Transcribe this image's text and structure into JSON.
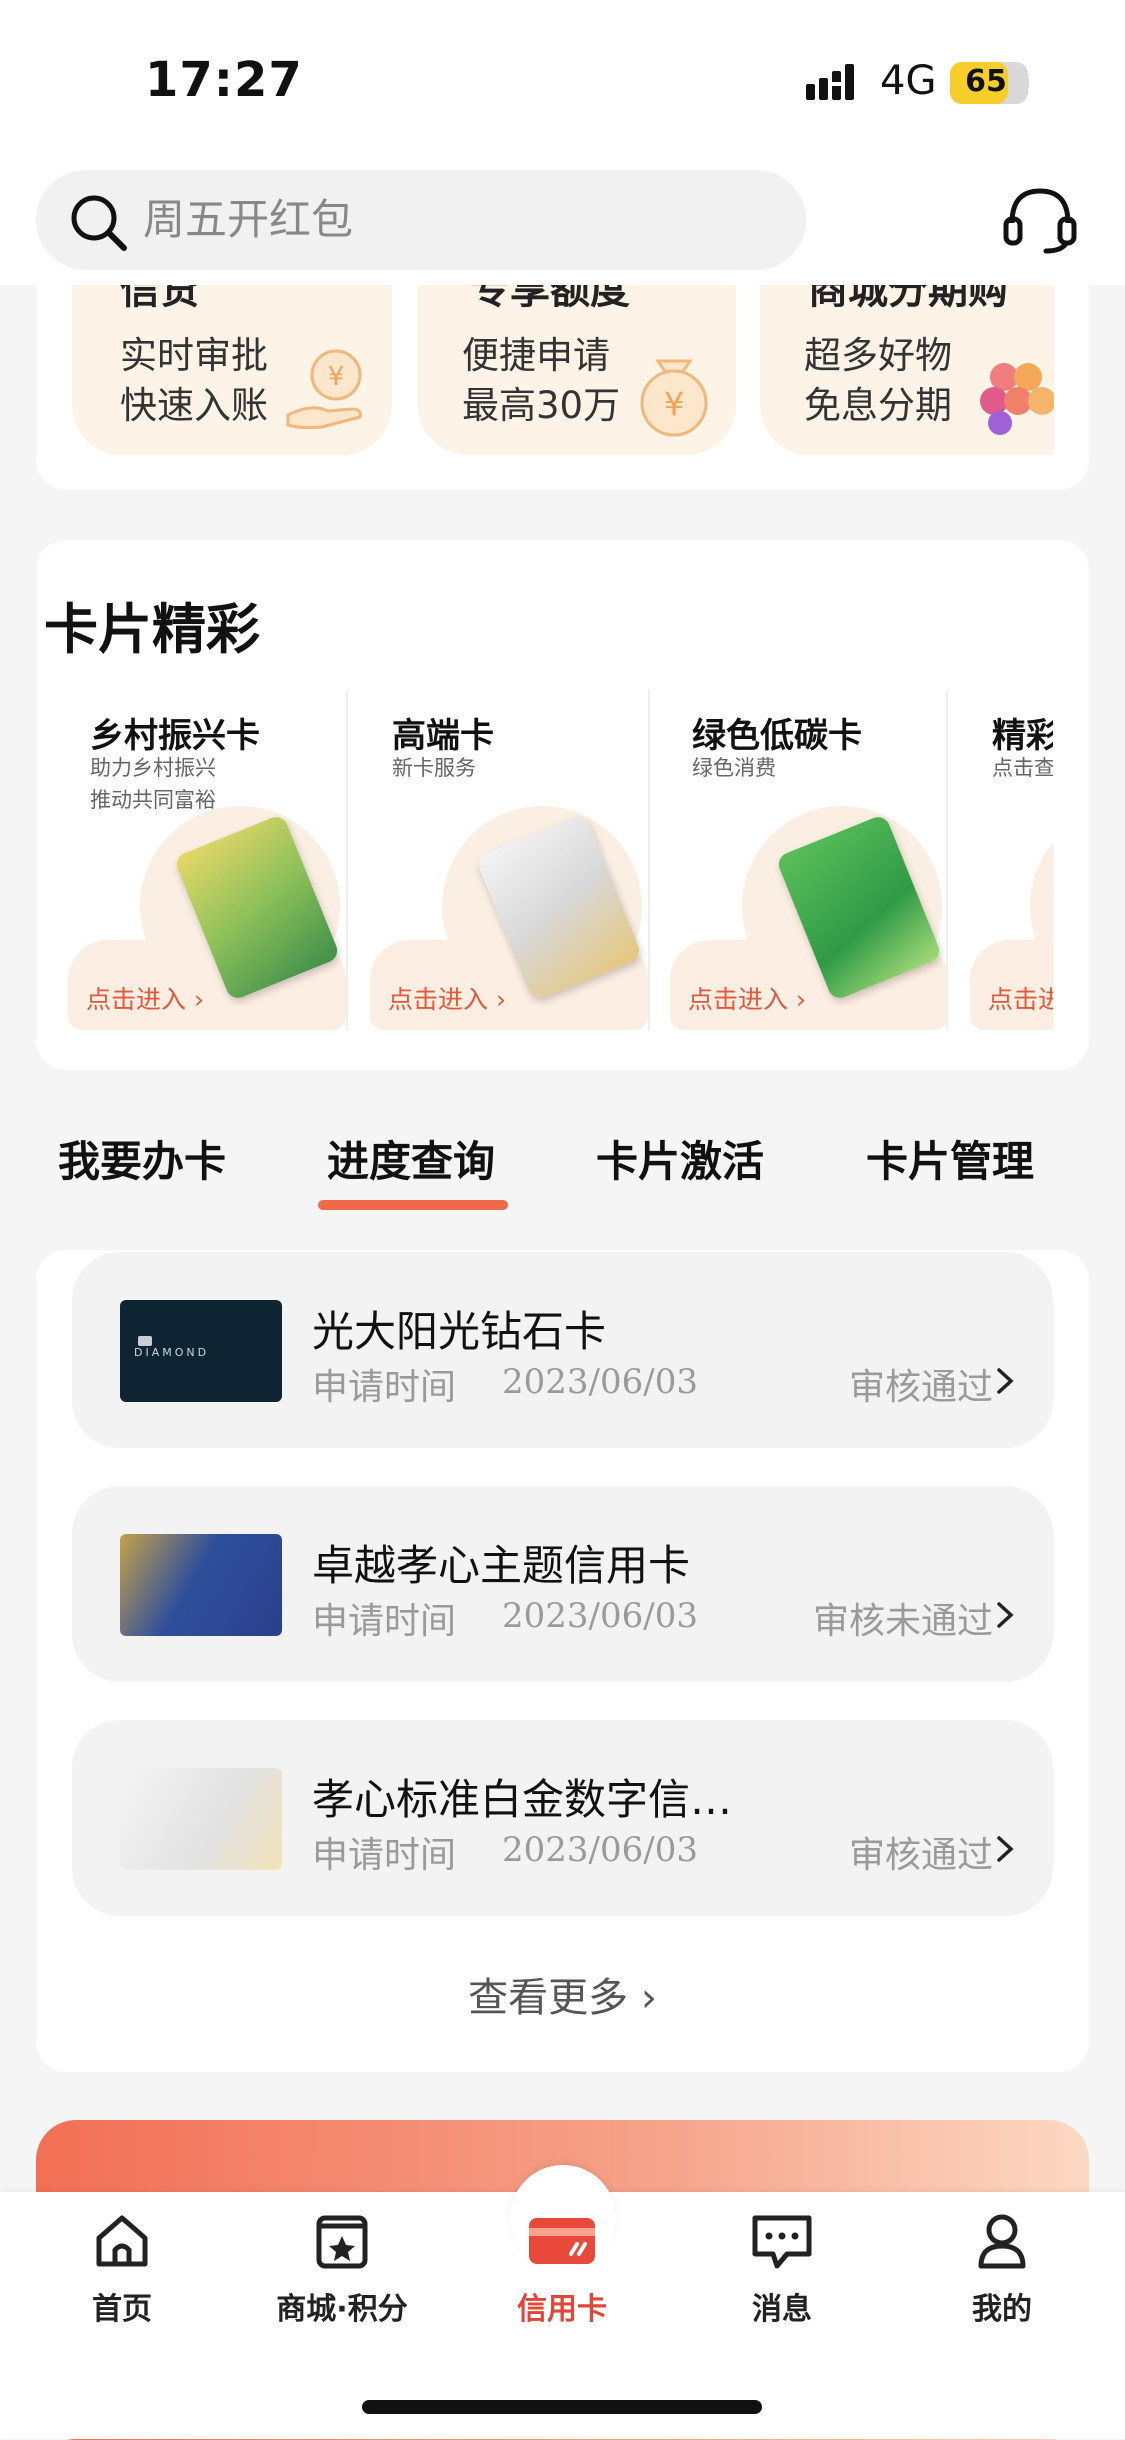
{
  "status_bar": {
    "time": "17:27",
    "network": "4G",
    "battery": "65"
  },
  "search": {
    "placeholder": "周五开红包"
  },
  "promo": [
    {
      "head": "信贷",
      "line1": "实时审批",
      "line2": "快速入账",
      "icon": "yen-hand-icon"
    },
    {
      "head": "专享额度",
      "line1": "便捷申请",
      "line2": "最高30万",
      "icon": "money-bag-icon"
    },
    {
      "head": "商城分期购",
      "line1": "超多好物",
      "line2": "免息分期",
      "icon": "fruit-icon"
    }
  ],
  "cards_section": {
    "title": "卡片精彩",
    "cards": [
      {
        "name": "乡村振兴卡",
        "sub": "助力乡村振兴\n推动共同富裕",
        "enter": "点击进入"
      },
      {
        "name": "高端卡",
        "sub": "新卡服务",
        "enter": "点击进入"
      },
      {
        "name": "绿色低碳卡",
        "sub": "绿色消费",
        "enter": "点击进入"
      },
      {
        "name": "精彩",
        "sub": "点击查",
        "enter": "点击进"
      }
    ]
  },
  "tabs": [
    "我要办卡",
    "进度查询",
    "卡片激活",
    "卡片管理"
  ],
  "active_tab": "进度查询",
  "applications": [
    {
      "title": "光大阳光钻石卡",
      "label": "申请时间",
      "date": "2023/06/03",
      "status": "审核通过"
    },
    {
      "title": "卓越孝心主题信用卡",
      "label": "申请时间",
      "date": "2023/06/03",
      "status": "审核未通过"
    },
    {
      "title": "孝心标准白金数字信…",
      "label": "申请时间",
      "date": "2023/06/03",
      "status": "审核通过"
    }
  ],
  "more_label": "查看更多",
  "bottom_nav": [
    {
      "label": "首页",
      "icon": "home-icon"
    },
    {
      "label": "商城·积分",
      "icon": "store-star-icon"
    },
    {
      "label": "信用卡",
      "icon": "credit-card-icon"
    },
    {
      "label": "消息",
      "icon": "message-icon"
    },
    {
      "label": "我的",
      "icon": "profile-icon"
    }
  ],
  "colors": {
    "accent": "#ee6a4b",
    "active_nav": "#e0463a",
    "promo_bg": "#fdf3e6"
  }
}
